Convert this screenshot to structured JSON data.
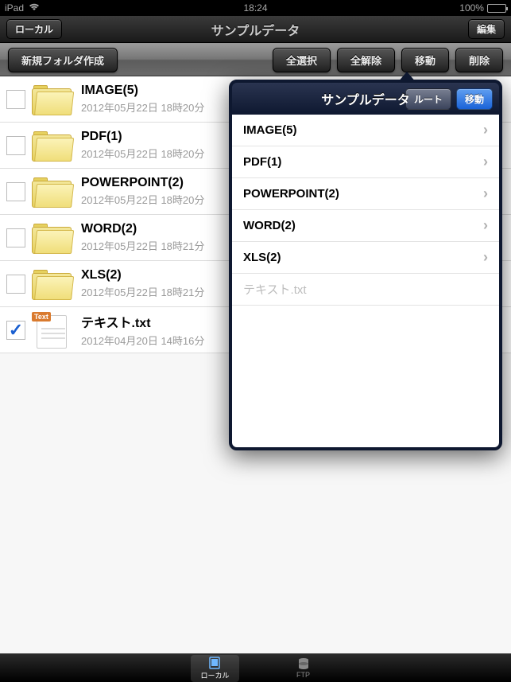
{
  "status": {
    "device": "iPad",
    "time": "18:24",
    "battery_pct": "100%"
  },
  "nav": {
    "back_label": "ローカル",
    "title": "サンプルデータ",
    "edit_label": "編集"
  },
  "toolbar": {
    "new_folder": "新規フォルダ作成",
    "select_all": "全選択",
    "deselect_all": "全解除",
    "move": "移動",
    "delete": "削除"
  },
  "files": [
    {
      "name": "IMAGE(5)",
      "date": "2012年05月22日 18時20分",
      "type": "folder",
      "checked": false
    },
    {
      "name": "PDF(1)",
      "date": "2012年05月22日 18時20分",
      "type": "folder",
      "checked": false
    },
    {
      "name": "POWERPOINT(2)",
      "date": "2012年05月22日 18時20分",
      "type": "folder",
      "checked": false
    },
    {
      "name": "WORD(2)",
      "date": "2012年05月22日 18時21分",
      "type": "folder",
      "checked": false
    },
    {
      "name": "XLS(2)",
      "date": "2012年05月22日 18時21分",
      "type": "folder",
      "checked": false
    },
    {
      "name": "テキスト.txt",
      "date": "2012年04月20日 14時16分",
      "type": "text",
      "checked": true
    }
  ],
  "popover": {
    "title": "サンプルデータ",
    "root_label": "ルート",
    "move_label": "移動",
    "items": [
      {
        "label": "IMAGE(5)",
        "nav": true
      },
      {
        "label": "PDF(1)",
        "nav": true
      },
      {
        "label": "POWERPOINT(2)",
        "nav": true
      },
      {
        "label": "WORD(2)",
        "nav": true
      },
      {
        "label": "XLS(2)",
        "nav": true
      },
      {
        "label": "テキスト.txt",
        "nav": false
      }
    ]
  },
  "tabs": {
    "local": "ローカル",
    "ftp": "FTP"
  },
  "file_badge_text": "Text"
}
